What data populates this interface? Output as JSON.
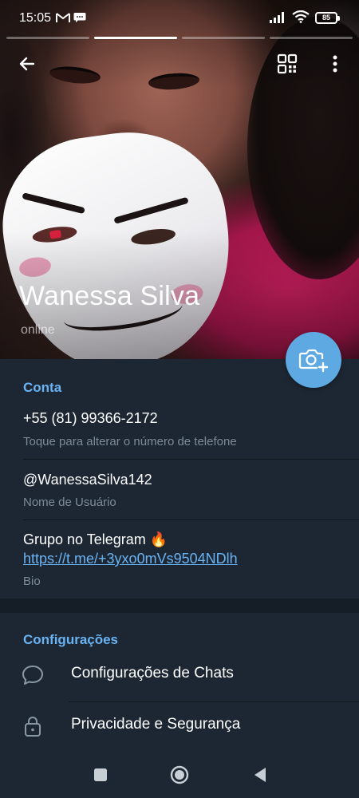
{
  "status_bar": {
    "time": "15:05",
    "battery": "85"
  },
  "stories": {
    "count": 4,
    "active_index": 1
  },
  "profile": {
    "name": "Wanessa Silva",
    "status": "online"
  },
  "account": {
    "section_title": "Conta",
    "phone": "+55 (81) 99366-2172",
    "phone_hint": "Toque para alterar o número de telefone",
    "username": "@WanessaSilva142",
    "username_hint": "Nome de Usuário",
    "bio_line1": "Grupo no Telegram 🔥",
    "bio_link": "https://t.me/+3yxo0mVs9504NDlh",
    "bio_hint": "Bio"
  },
  "settings": {
    "section_title": "Configurações",
    "items": [
      {
        "label": "Configurações de Chats",
        "icon": "chat-bubble-icon"
      },
      {
        "label": "Privacidade e Segurança",
        "icon": "lock-icon"
      }
    ]
  },
  "colors": {
    "accent": "#6ab3f3",
    "fab": "#5fa9e3",
    "background": "#1d2733",
    "section_gap": "#151e27",
    "hint_text": "#7d8b99"
  }
}
